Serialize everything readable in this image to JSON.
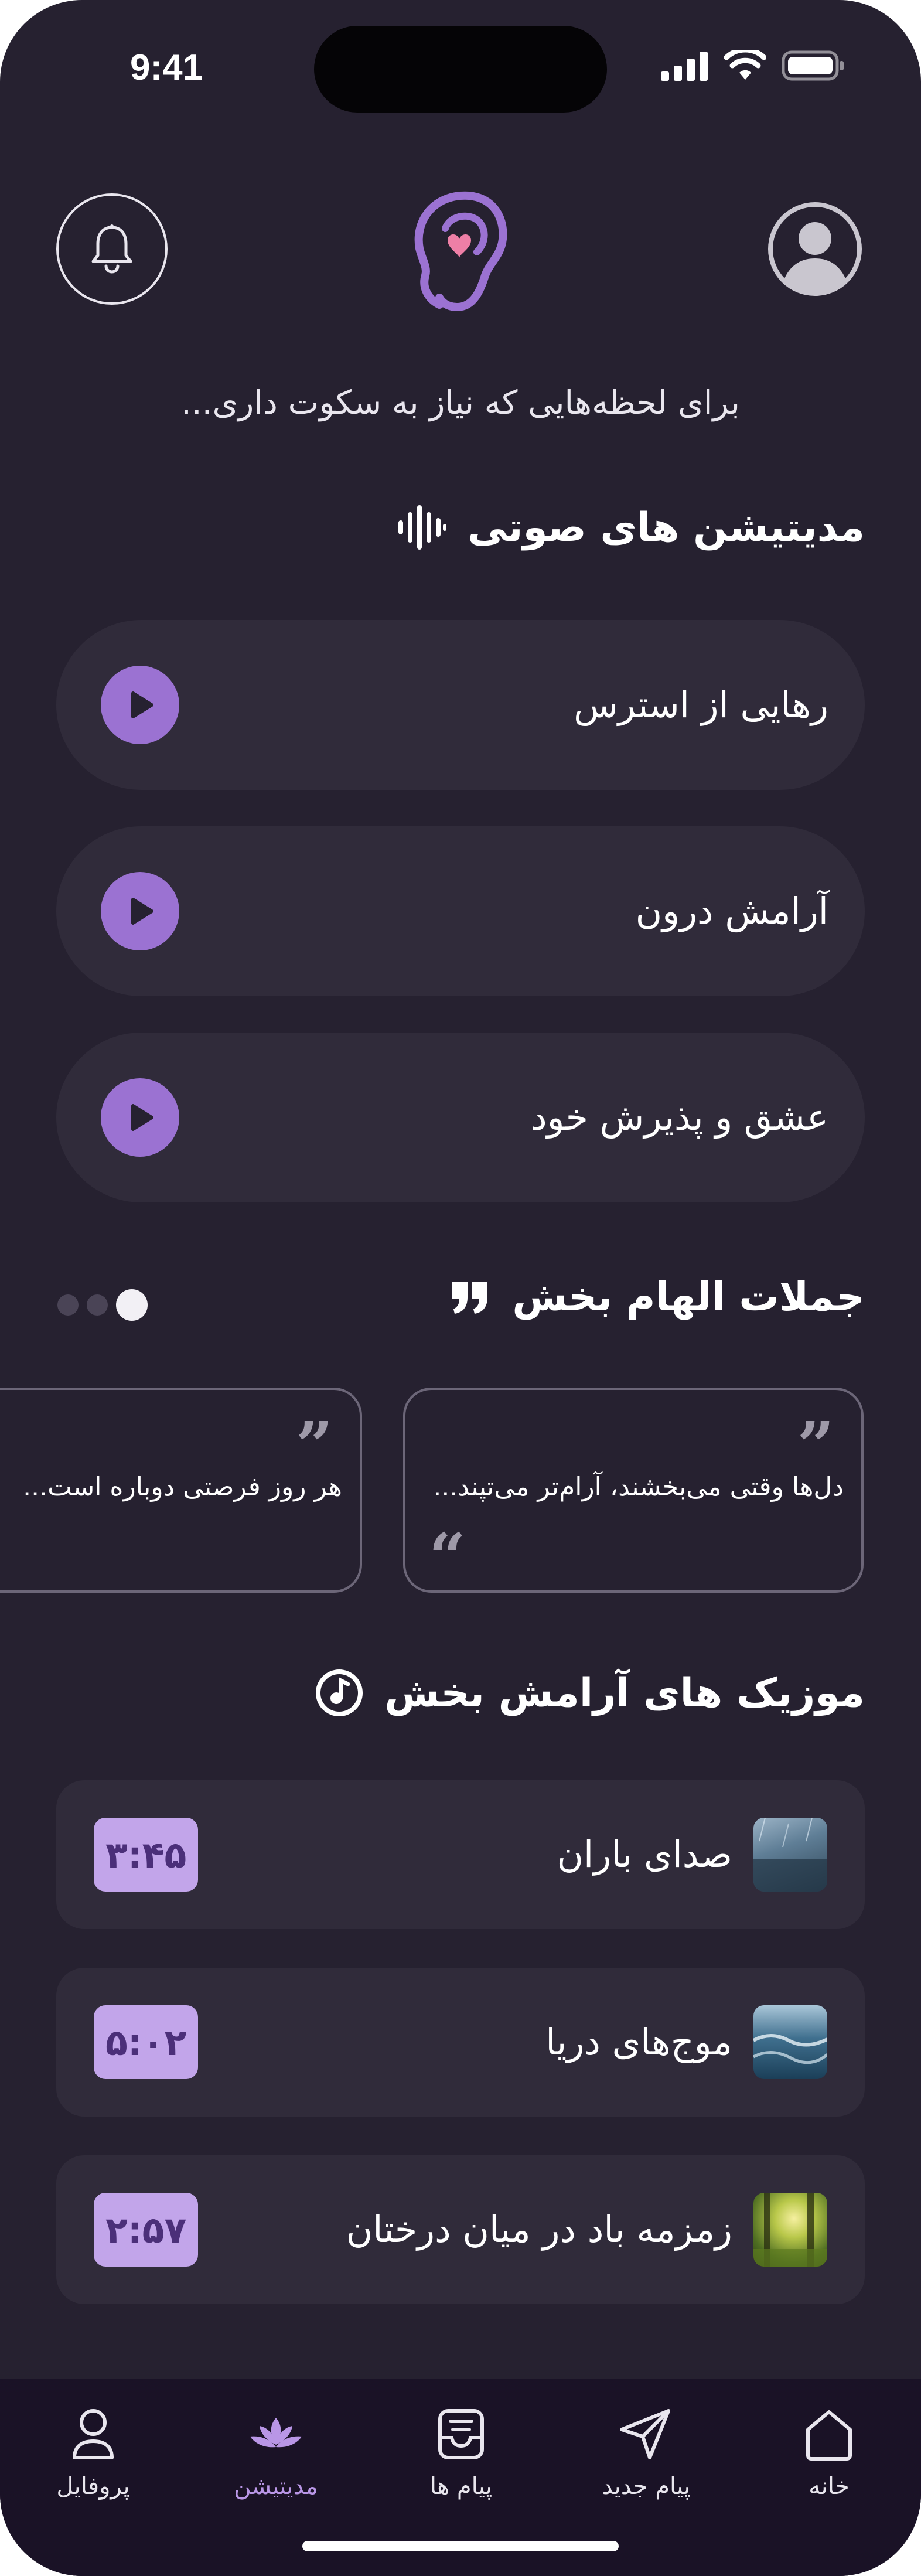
{
  "status_bar": {
    "time": "9:41"
  },
  "header": {
    "tagline": "برای لحظه‌هایی که نیاز به سکوت داری..."
  },
  "audio_meditations": {
    "title": "مدیتیشن های صوتی",
    "items": [
      {
        "label": "رهایی از استرس"
      },
      {
        "label": "آرامش درون"
      },
      {
        "label": "عشق و پذیرش خود"
      }
    ]
  },
  "quotes": {
    "title": "جملات الهام بخش",
    "active_page": 1,
    "page_count": 3,
    "items": [
      {
        "text": "دل‌ها وقتی می‌بخشند، آرام‌تر می‌تپند..."
      },
      {
        "text": "هر روز فرصتی دوباره است..."
      }
    ]
  },
  "music": {
    "title": "موزیک های آرامش بخش",
    "items": [
      {
        "title": "صدای باران",
        "duration": "۳:۴۵"
      },
      {
        "title": "موج‌های دریا",
        "duration": "۵:۰۲"
      },
      {
        "title": "زمزمه باد در میان درختان",
        "duration": "۲:۵۷"
      }
    ]
  },
  "bottom_nav": {
    "items": [
      {
        "label": "خانه",
        "icon": "home-icon"
      },
      {
        "label": "پیام جدید",
        "icon": "send-icon"
      },
      {
        "label": "پیام ها",
        "icon": "inbox-icon"
      },
      {
        "label": "مدیتیشن",
        "icon": "lotus-icon",
        "active": true
      },
      {
        "label": "پروفایل",
        "icon": "user-icon"
      }
    ]
  },
  "colors": {
    "background": "#262130",
    "card": "#302b3a",
    "accent": "#9b72d2",
    "duration_badge": "#c2a5ea",
    "heart": "#ee7fa6",
    "nav_bg": "#1a1226"
  }
}
